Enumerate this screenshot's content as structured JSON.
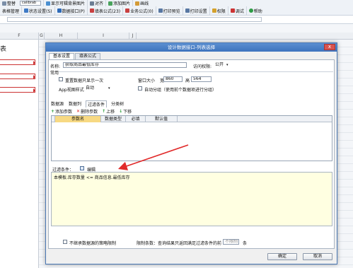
{
  "app": {
    "toolbar1": [
      "整替",
      "calibrab",
      "显示可辑背景图片",
      "对齐",
      "添加图片",
      "画线"
    ],
    "toolbar2": [
      "表格管理",
      "状态设置(S)",
      "数据接口(P)",
      "填表公式(23)",
      "业务公式(0)",
      "打印预览",
      "打印设置",
      "权限",
      "调试",
      "帮助"
    ],
    "columns": [
      "F",
      "G",
      "H",
      "I",
      "J"
    ],
    "side_title": "表"
  },
  "dialog": {
    "title": "设计数据接口-列表选择",
    "close": "x",
    "tabs": [
      "基本设置",
      "填表公式"
    ],
    "name_label": "名称:",
    "name_value": "获取商品最低库存",
    "access_label": "访问权限:",
    "access_value": "公开",
    "group_label": "常用",
    "repeat_label": "重置数据只显示一次",
    "view_label": "App视图样式",
    "view_value": "自动",
    "window_label": "窗口大小",
    "width_label": "宽",
    "width_value": "860",
    "height_label": "高",
    "height_value": "564",
    "autogroup_label": "自动分组（使用前个数据项进行分组）",
    "subtabs": [
      "数据源",
      "数据列",
      "过滤条件",
      "分类树"
    ],
    "actions": {
      "add": "添加参数",
      "delete": "删除参数",
      "up": "上移",
      "down": "下移"
    },
    "grid_headers": [
      "参数名",
      "数据类型",
      "必填",
      "默认值"
    ],
    "filter_label": "过滤条件：",
    "edit_label": "编辑",
    "filter_text": "本模板.库存数量  <=  商品信息.最低库存",
    "no_inherit_label": "不继承数据源的策略限制",
    "limit_label": "限制条数：查询结果只返回满足过滤条件的前",
    "limit_placeholder": "不限制",
    "limit_unit": "条",
    "ok": "确定",
    "cancel": "取消"
  },
  "colors": {
    "title_bar": "#3d73bd",
    "condition_bg": "#ffffe1",
    "highlight_header": "#f7d983",
    "arrow": "#e12a2a"
  }
}
